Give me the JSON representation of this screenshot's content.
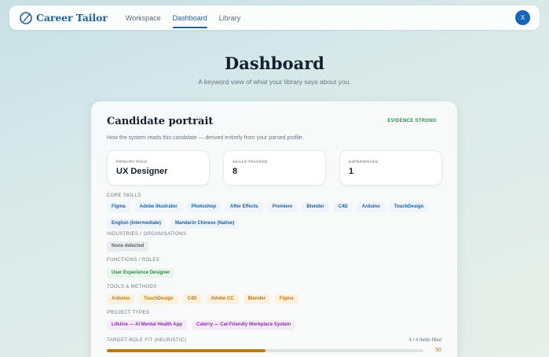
{
  "brand": {
    "name": "Career Tailor"
  },
  "nav": [
    {
      "label": "Workspace",
      "active": false
    },
    {
      "label": "Dashboard",
      "active": true
    },
    {
      "label": "Library",
      "active": false
    }
  ],
  "user": {
    "initial": "X"
  },
  "page": {
    "title": "Dashboard",
    "subtitle": "A keyword view of what your library says about you."
  },
  "portrait": {
    "title": "Candidate portrait",
    "evidence": "EVIDENCE STRONG",
    "description": "How the system reads this candidate — derived entirely from your parsed profile.",
    "stats": [
      {
        "label": "PRIMARY ROLE",
        "value": "UX Designer"
      },
      {
        "label": "SKILLS TRACKED",
        "value": "8"
      },
      {
        "label": "EXPERIENCES",
        "value": "1"
      }
    ],
    "core_skills": {
      "label": "CORE SKILLS",
      "items": [
        "Figma",
        "Adobe Illustrator",
        "Photoshop",
        "After Effects",
        "Premiere",
        "Blender",
        "C4D",
        "Arduino",
        "TouchDesign",
        "English (Intermediate)",
        "Mandarin Chinese (Native)"
      ]
    },
    "industries": {
      "label": "INDUSTRIES / ORGANISATIONS",
      "items": [
        "None detected"
      ]
    },
    "functions": {
      "label": "FUNCTIONS / ROLES",
      "items": [
        "User Experience Designer"
      ]
    },
    "tools": {
      "label": "TOOLS & METHODS",
      "items": [
        "Arduino",
        "TouchDesign",
        "C4D",
        "Adobe CC",
        "Blender",
        "Figma"
      ]
    },
    "projects": {
      "label": "PROJECT TYPES",
      "items": [
        "Lifeline — AI Mental Health App",
        "Caterry — Cat-Friendly Workplace System"
      ]
    },
    "fit": {
      "label": "TARGET-ROLE FIT (HEURISTIC)",
      "filled": "4 / 4 fields filled",
      "score": "50",
      "fraction": 0.5
    }
  },
  "colors": {
    "accent": "#1f5fa8",
    "evidence": "#2e8b4a",
    "fit": "#c07a0c",
    "avatar": "#1565c0"
  }
}
